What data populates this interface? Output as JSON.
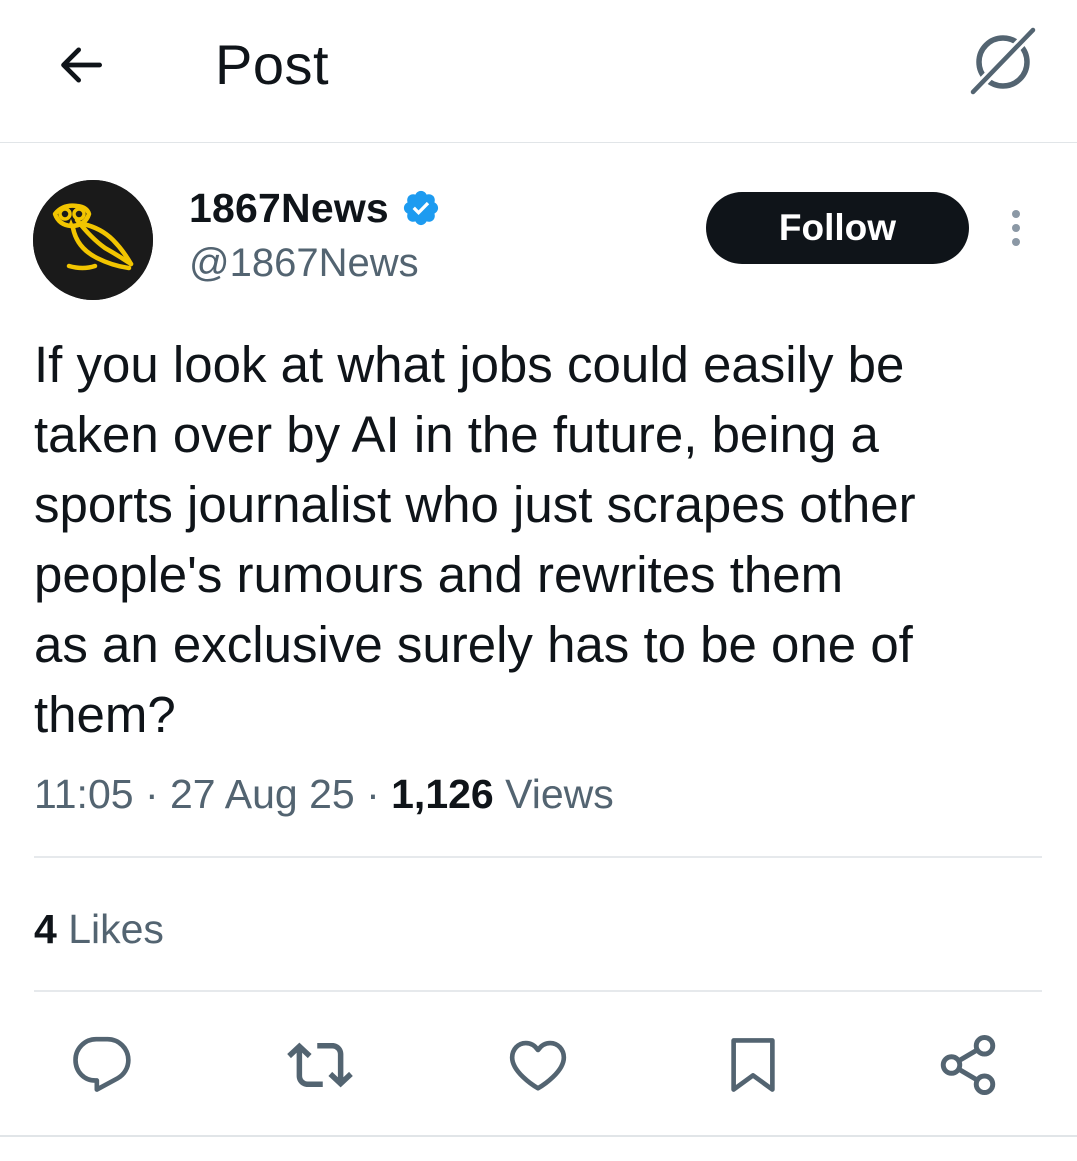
{
  "header": {
    "title": "Post",
    "back_icon": "arrow-left-icon",
    "grok_icon": "grok-icon"
  },
  "author": {
    "display_name": "1867News",
    "handle": "@1867News",
    "verified": true,
    "verified_color": "#1d9bf0",
    "avatar_icon": "owl-logo",
    "avatar_colors": {
      "background": "#1a1a1a",
      "logo": "#f2c500"
    }
  },
  "follow_button": {
    "label": "Follow"
  },
  "tweet": {
    "text": "If you look at what jobs could easily be\ntaken over by AI in the future, being a\nsports journalist who just scrapes other\npeople's rumours and rewrites them\nas an exclusive surely has to be one of\nthem?"
  },
  "meta": {
    "time": "11:05",
    "separator": " · ",
    "date": "27 Aug 25",
    "views_count": "1,126",
    "views_label": " Views"
  },
  "stats": {
    "likes_count": "4",
    "likes_label": " Likes"
  },
  "actions": [
    {
      "icon": "reply-icon"
    },
    {
      "icon": "repost-icon"
    },
    {
      "icon": "like-icon"
    },
    {
      "icon": "bookmark-icon"
    },
    {
      "icon": "share-icon"
    }
  ],
  "colors": {
    "text_primary": "#0f1419",
    "text_secondary": "#536471",
    "divider": "#e6e9ec"
  }
}
